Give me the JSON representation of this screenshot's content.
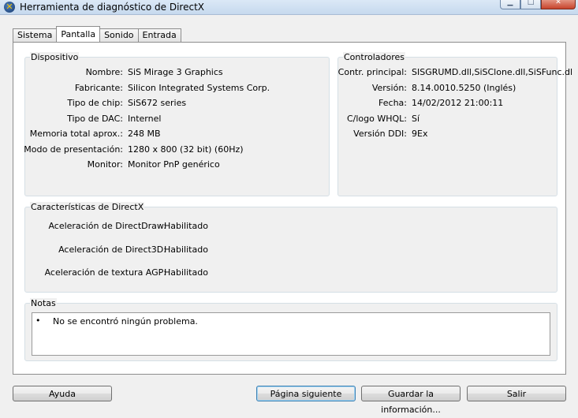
{
  "window": {
    "title": "Herramienta de diagnóstico de DirectX"
  },
  "tabs": [
    "Sistema",
    "Pantalla",
    "Sonido",
    "Entrada"
  ],
  "active_tab": "Pantalla",
  "device": {
    "legend": "Dispositivo",
    "rows": [
      {
        "label": "Nombre:",
        "value": "SiS Mirage 3 Graphics"
      },
      {
        "label": "Fabricante:",
        "value": "Silicon Integrated Systems Corp."
      },
      {
        "label": "Tipo de chip:",
        "value": "SiS672 series"
      },
      {
        "label": "Tipo de DAC:",
        "value": "Internel"
      },
      {
        "label": "Memoria total aprox.:",
        "value": "248 MB"
      },
      {
        "label": "Modo de presentación:",
        "value": "1280 x 800 (32 bit) (60Hz)"
      },
      {
        "label": "Monitor:",
        "value": "Monitor PnP genérico"
      }
    ]
  },
  "drivers": {
    "legend": "Controladores",
    "rows": [
      {
        "label": "Contr. principal:",
        "value": "SISGRUMD.dll,SiSClone.dll,SiSFunc.dl"
      },
      {
        "label": "Versión:",
        "value": "8.14.0010.5250 (Inglés)"
      },
      {
        "label": "Fecha:",
        "value": "14/02/2012 21:00:11"
      },
      {
        "label": "C/logo WHQL:",
        "value": "Sí"
      },
      {
        "label": "Versión DDI:",
        "value": "9Ex"
      }
    ]
  },
  "features": {
    "legend": "Características de DirectX",
    "rows": [
      {
        "label": "Aceleración de DirectDraw:",
        "value": "Habilitado"
      },
      {
        "label": "Aceleración de Direct3D:",
        "value": "Habilitado"
      },
      {
        "label": "Aceleración de textura AGP:",
        "value": "Habilitado"
      }
    ]
  },
  "notes": {
    "legend": "Notas",
    "bullet": "•",
    "text": "No se encontró ningún problema."
  },
  "buttons": {
    "help": "Ayuda",
    "next_page": "Página siguiente",
    "save_info": "Guardar la información...",
    "exit": "Salir"
  },
  "icons": {
    "app": "directx-icon",
    "minimize": "minimize-icon",
    "maximize": "maximize-icon",
    "close": "close-icon"
  }
}
